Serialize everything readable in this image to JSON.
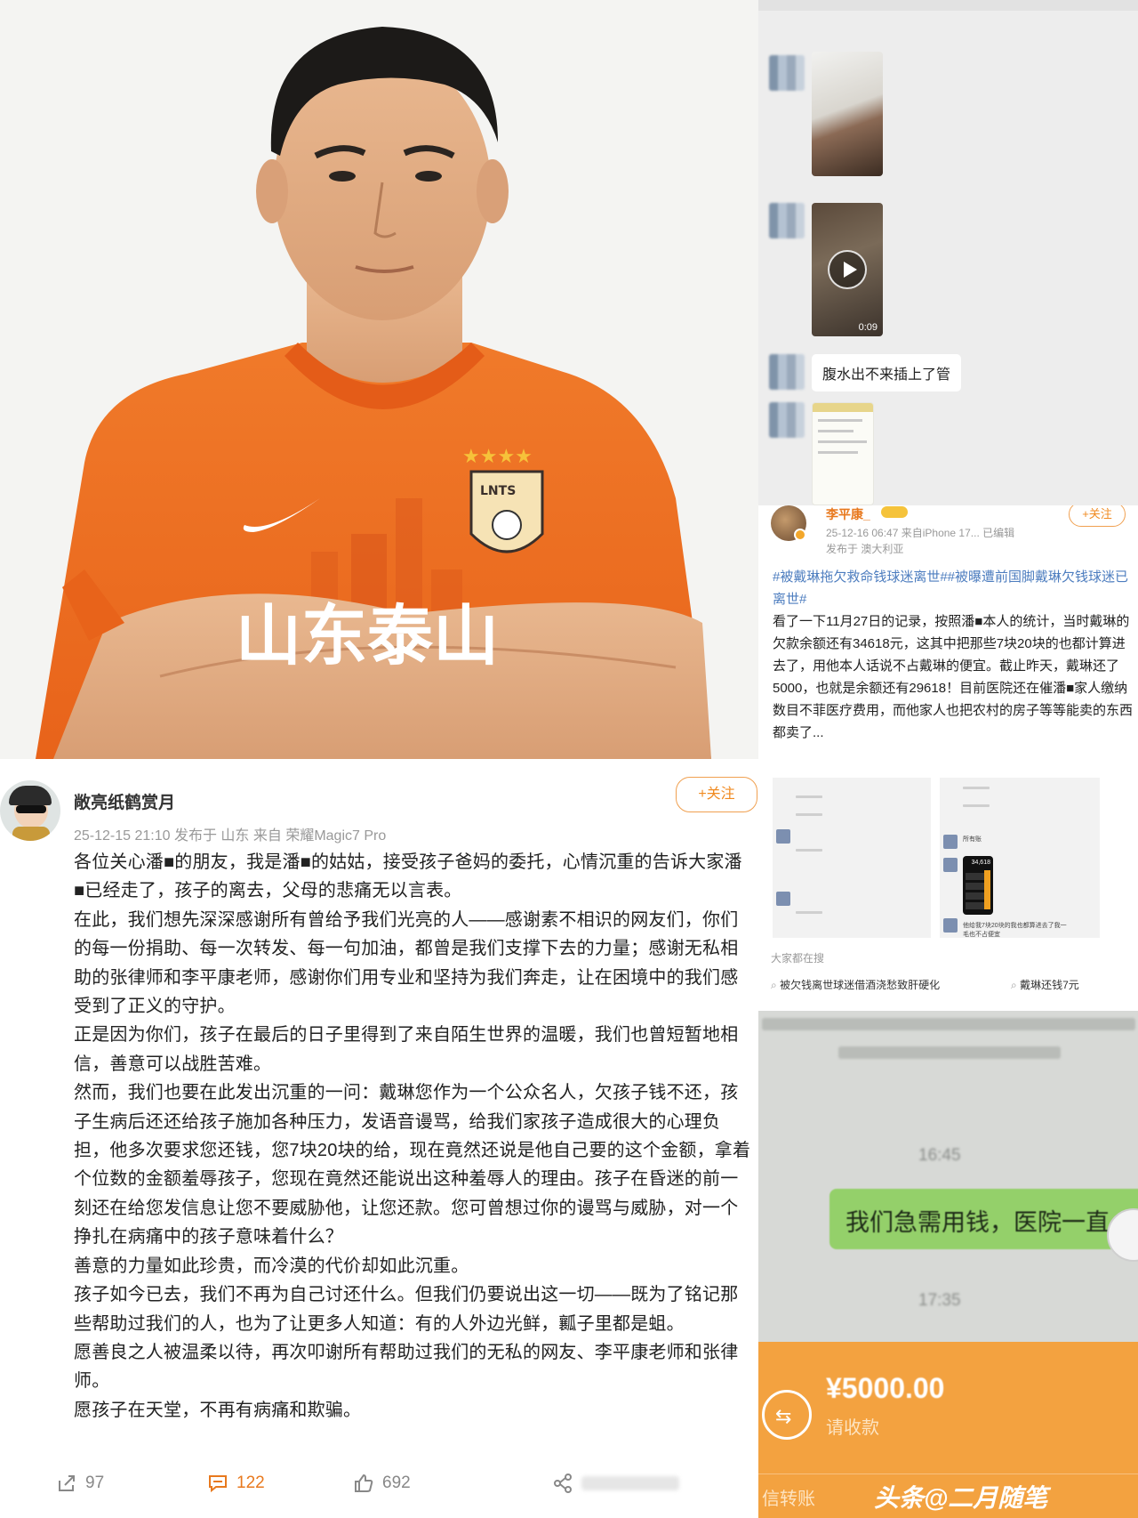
{
  "photo": {
    "jersey_text": "山东泰山",
    "crest_text": "LNTS"
  },
  "chat": {
    "video_duration": "0:09",
    "message_text": "腹水出不来插上了管"
  },
  "post2": {
    "author": "李平康_",
    "follow_label": "+关注",
    "meta_line": "25-12-16 06:47  来自iPhone 17...  已编辑",
    "location_line": "发布于 澳大利亚",
    "hashtags": "#被戴琳拖欠救命钱球迷离世##被曝遭前国脚戴琳欠钱球迷已离世#",
    "body": "看了一下11月27日的记录，按照潘■本人的统计，当时戴琳的欠款余额还有34618元，这其中把那些7块20块的也都计算进去了，用他本人话说不占戴琳的便宜。截止昨天，戴琳还了5000，也就是余额还有29618！目前医院还在催潘■家人缴纳数目不菲医疗费用，而他家人也把农村的房子等等能卖的东西都卖了...",
    "thumb_caption": "他给我7块20块的我也都算进去了我一毛也不占便宜",
    "thumb_label": "所有账",
    "calc_value": "34,618",
    "search_header": "大家都在搜",
    "search_items": [
      "被欠钱离世球迷借酒浇愁致肝硬化",
      "戴琳还钱7元"
    ]
  },
  "transfer": {
    "time1": "16:45",
    "message": "我们急需用钱，医院一直",
    "time2": "17:35",
    "amount": "¥5000.00",
    "status": "请收款",
    "footer": "信转账",
    "watermark": "头条@二月随笔"
  },
  "post1": {
    "author": "敞亮纸鹤赏月",
    "follow_label": "+关注",
    "meta_line": "25-12-15 21:10 发布于 山东 来自 荣耀Magic7 Pro",
    "paragraphs": [
      "各位关心潘■的朋友，我是潘■的姑姑，接受孩子爸妈的委托，心情沉重的告诉大家潘■已经走了，孩子的离去，父母的悲痛无以言表。",
      "在此，我们想先深深感谢所有曾给予我们光亮的人——感谢素不相识的网友们，你们的每一份捐助、每一次转发、每一句加油，都曾是我们支撑下去的力量；感谢无私相助的张律师和李平康老师，感谢你们用专业和坚持为我们奔走，让在困境中的我们感受到了正义的守护。",
      "正是因为你们，孩子在最后的日子里得到了来自陌生世界的温暖，我们也曾短暂地相信，善意可以战胜苦难。",
      "然而，我们也要在此发出沉重的一问：戴琳您作为一个公众名人，欠孩子钱不还，孩子生病后还还给孩子施加各种压力，发语音谩骂，给我们家孩子造成很大的心理负担，他多次要求您还钱，您7块20块的给，现在竟然还说是他自己要的这个金额，拿着个位数的金额羞辱孩子，您现在竟然还能说出这种羞辱人的理由。孩子在昏迷的前一刻还在给您发信息让您不要威胁他，让您还款。您可曾想过你的谩骂与威胁，对一个挣扎在病痛中的孩子意味着什么？",
      "善意的力量如此珍贵，而冷漠的代价却如此沉重。",
      "孩子如今已去，我们不再为自己讨还什么。但我们仍要说出这一切——既为了铭记那些帮助过我们的人，也为了让更多人知道：有的人外边光鲜，瓤子里都是蛆。",
      "愿善良之人被温柔以待，再次叩谢所有帮助过我们的无私的网友、李平康老师和张律师。",
      "愿孩子在天堂，不再有病痛和欺骗。"
    ],
    "share_count": "97",
    "comment_count": "122",
    "like_count": "692"
  }
}
